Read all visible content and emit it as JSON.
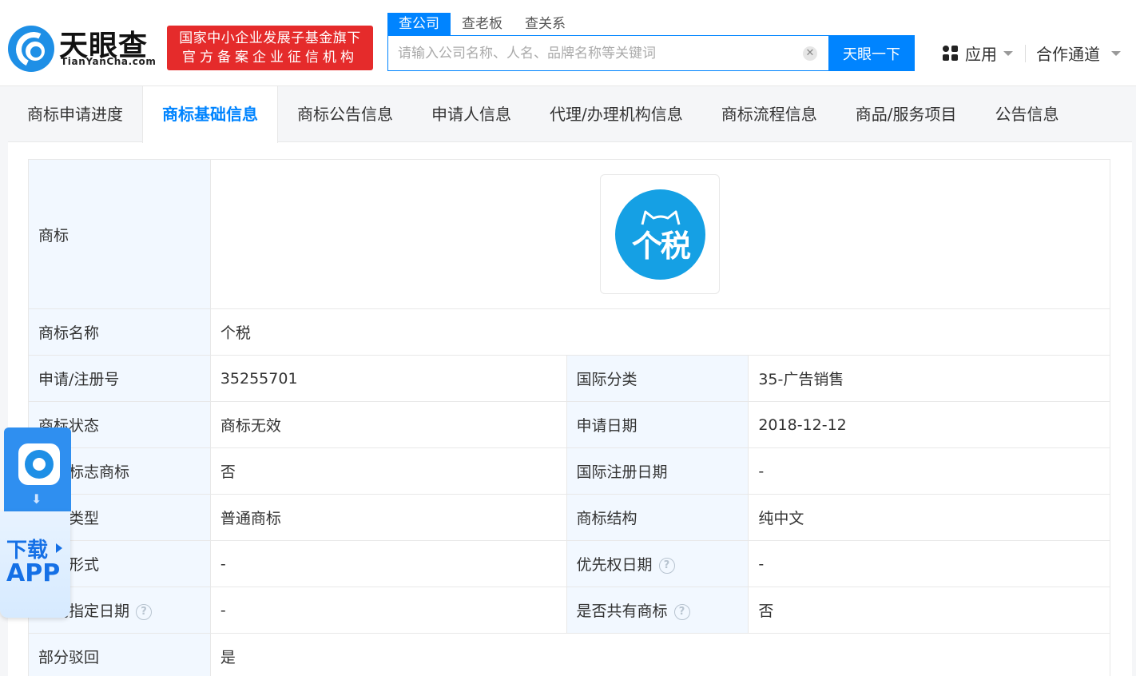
{
  "header": {
    "logo_title": "天眼查",
    "logo_subtitle": "TianYanCha.com",
    "badge_line1": "国家中小企业发展子基金旗下",
    "badge_line2": "官方备案企业征信机构",
    "search_tabs": [
      "查公司",
      "查老板",
      "查关系"
    ],
    "search_placeholder": "请输入公司名称、人名、品牌名称等关键词",
    "search_button": "天眼一下",
    "apps_label": "应用",
    "partner_label": "合作通道"
  },
  "tabs": [
    "商标申请进度",
    "商标基础信息",
    "商标公告信息",
    "申请人信息",
    "代理/办理机构信息",
    "商标流程信息",
    "商品/服务项目",
    "公告信息"
  ],
  "active_tab": "商标基础信息",
  "trademark": {
    "logo_label": "商标",
    "logo_text": "个税",
    "name_label": "商标名称",
    "name_value": "个税",
    "rows": [
      {
        "l1": "申请/注册号",
        "v1": "35255701",
        "l2": "国际分类",
        "v2": "35-广告销售",
        "h1": false,
        "h2": false
      },
      {
        "l1": "商标状态",
        "v1": "商标无效",
        "l2": "申请日期",
        "v2": "2018-12-12",
        "h1": false,
        "h2": false
      },
      {
        "l1": "地理标志商标",
        "v1": "否",
        "l2": "国际注册日期",
        "v2": "-",
        "h1": false,
        "h2": false
      },
      {
        "l1": "商标类型",
        "v1": "普通商标",
        "l2": "商标结构",
        "v2": "纯中文",
        "h1": false,
        "h2": false
      },
      {
        "l1": "商标形式",
        "v1": "-",
        "l2": "优先权日期",
        "v2": "-",
        "h1": false,
        "h2": true
      },
      {
        "l1": "后期指定日期",
        "v1": "-",
        "l2": "是否共有商标",
        "v2": "否",
        "h1": true,
        "h2": true
      }
    ],
    "rejected_label": "部分驳回",
    "rejected_value": "是"
  },
  "app_float": {
    "line1": "下载",
    "line2": "APP"
  },
  "colors": {
    "accent": "#0084ff",
    "badge_red": "#e52b2b",
    "label_bg": "#f2f8ff",
    "trademark_blue": "#15a0e4"
  }
}
